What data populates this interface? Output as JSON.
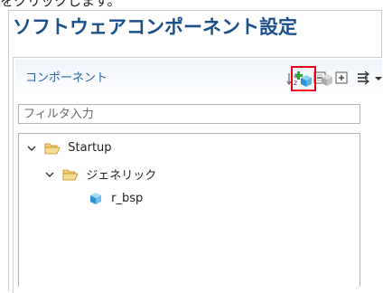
{
  "top_text": "をクリックします。",
  "title": "ソフトウェアコンポーネント設定",
  "panel": {
    "tab_label": "コンポーネント",
    "toolbar": [
      {
        "icon": "sort-az-icon"
      },
      {
        "icon": "collapse-all-icon"
      },
      {
        "icon": "expand-all-icon"
      },
      {
        "icon": "filter-arrows-icon"
      },
      {
        "icon": "view-menu-dropdown-icon"
      }
    ],
    "add_component_icon": "add-component-icon",
    "remove_component_icon": "remove-component-icon"
  },
  "filter": {
    "placeholder": "フィルタ入力",
    "value": ""
  },
  "tree": [
    {
      "label": "Startup",
      "level": 0,
      "type": "folder",
      "expanded": true
    },
    {
      "label": "ジェネリック",
      "level": 1,
      "type": "folder",
      "expanded": true
    },
    {
      "label": "r_bsp",
      "level": 2,
      "type": "component"
    }
  ],
  "colors": {
    "title": "#1b4f8c",
    "tab_label": "#2a63a8",
    "highlight_box": "#e60012",
    "folder": "#e8b54a"
  }
}
